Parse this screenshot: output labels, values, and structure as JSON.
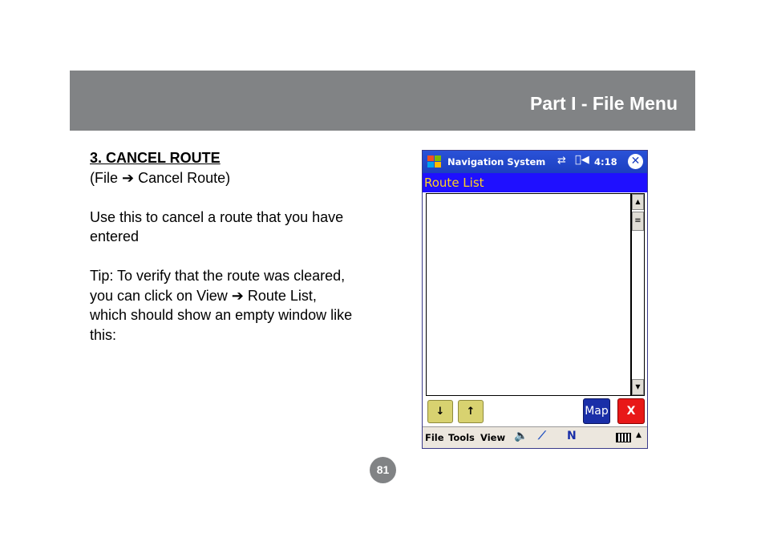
{
  "header": {
    "title": "Part I - File Menu",
    "band_color": "#818385"
  },
  "section": {
    "heading": "3. CANCEL ROUTE",
    "path": "(File ➔ Cancel Route)",
    "description": "Use this to cancel a route that you have entered",
    "tip": "Tip: To verify that the route was cleared, you can click on View ➔ Route List, which should show an empty window like this:"
  },
  "pda": {
    "titlebar": {
      "title": "Navigation System",
      "time": "4:18",
      "close_glyph": "✕"
    },
    "subtitle": "Route List",
    "colors": {
      "titlebar": "#1c3fc0",
      "subtitle_bg": "#1f10ff",
      "subtitle_text": "#ffd31f"
    },
    "buttons": {
      "down": "↓",
      "up": "↑",
      "map": "Map",
      "close": "X"
    },
    "scrollbar": {
      "up": "▲",
      "down": "▼",
      "thumb": "≡"
    },
    "menu": [
      "File",
      "Tools",
      "View"
    ],
    "icons": [
      "windows-start-icon",
      "connectivity-icon",
      "volume-icon",
      "close-icon",
      "speaker-icon",
      "satellite-icon",
      "compass-north-icon",
      "keyboard-icon"
    ]
  },
  "page_number": "81"
}
